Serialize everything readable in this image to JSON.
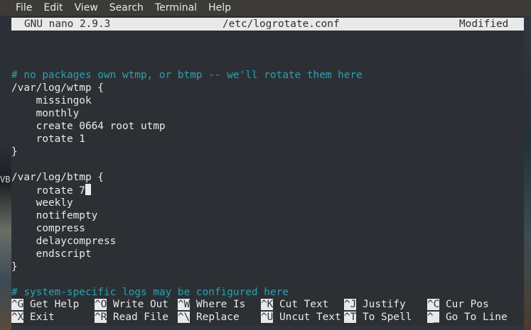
{
  "menubar": {
    "items": [
      "File",
      "Edit",
      "View",
      "Search",
      "Terminal",
      "Help"
    ]
  },
  "desktop": {
    "fragment_text": "VB"
  },
  "nano": {
    "version": "GNU nano 2.9.3",
    "filename": "/etc/logrotate.conf",
    "status": "Modified"
  },
  "editor": {
    "lines": [
      {
        "text": "",
        "type": "blank"
      },
      {
        "text": "# no packages own wtmp, or btmp -- we'll rotate them here",
        "type": "comment"
      },
      {
        "text": "/var/log/wtmp {",
        "type": "code"
      },
      {
        "text": "    missingok",
        "type": "code"
      },
      {
        "text": "    monthly",
        "type": "code"
      },
      {
        "text": "    create 0664 root utmp",
        "type": "code"
      },
      {
        "text": "    rotate 1",
        "type": "code"
      },
      {
        "text": "}",
        "type": "code"
      },
      {
        "text": "",
        "type": "blank"
      },
      {
        "text": "/var/log/btmp {",
        "type": "code"
      },
      {
        "text": "    rotate 7",
        "type": "code",
        "cursor_after": true
      },
      {
        "text": "    weekly",
        "type": "code"
      },
      {
        "text": "    notifempty",
        "type": "code"
      },
      {
        "text": "    compress",
        "type": "code"
      },
      {
        "text": "    delaycompress",
        "type": "code"
      },
      {
        "text": "    endscript",
        "type": "code"
      },
      {
        "text": "}",
        "type": "code"
      },
      {
        "text": "",
        "type": "blank"
      },
      {
        "text": "# system-specific logs may be configured here",
        "type": "comment"
      }
    ]
  },
  "shortcuts": {
    "row1": [
      {
        "key": "^G",
        "label": "Get Help"
      },
      {
        "key": "^O",
        "label": "Write Out"
      },
      {
        "key": "^W",
        "label": "Where Is"
      },
      {
        "key": "^K",
        "label": "Cut Text"
      },
      {
        "key": "^J",
        "label": "Justify"
      },
      {
        "key": "^C",
        "label": "Cur Pos"
      }
    ],
    "row2": [
      {
        "key": "^X",
        "label": "Exit"
      },
      {
        "key": "^R",
        "label": "Read File"
      },
      {
        "key": "^\\",
        "label": "Replace"
      },
      {
        "key": "^U",
        "label": "Uncut Text"
      },
      {
        "key": "^T",
        "label": "To Spell"
      },
      {
        "key": "^_",
        "label": "Go To Line"
      }
    ]
  },
  "colors": {
    "background": "#2c3034",
    "foreground": "#eaeaea",
    "comment": "#2aa1b3",
    "titlebar": "#e9e9e9"
  }
}
